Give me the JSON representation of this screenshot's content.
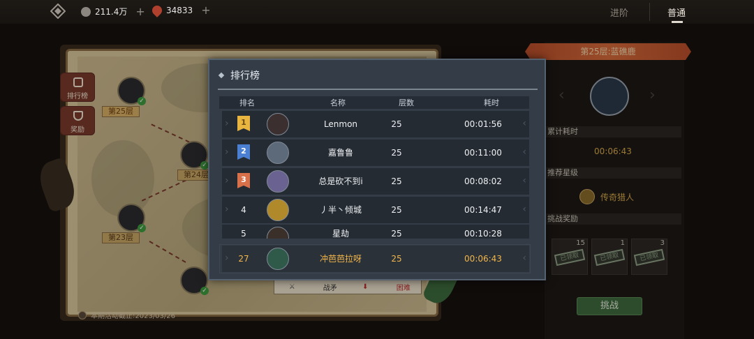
{
  "topbar": {
    "resources": [
      {
        "icon": "coin-icon",
        "value": "211.4万",
        "plus": "+"
      },
      {
        "icon": "blood-drop-icon",
        "value": "34833",
        "plus": "+"
      }
    ],
    "tabs": [
      {
        "label": "进阶",
        "active": false
      },
      {
        "label": "普通",
        "active": true
      }
    ]
  },
  "map": {
    "side_buttons": [
      {
        "icon": "leaderboard-icon",
        "label": "排行榜"
      },
      {
        "icon": "trophy-icon",
        "label": "奖励"
      }
    ],
    "floors": [
      {
        "label": "第25层",
        "cleared": true,
        "active": true
      },
      {
        "label": "第24层",
        "cleared": true,
        "active": false
      },
      {
        "label": "第23层",
        "cleared": true,
        "active": false
      }
    ],
    "card_tags": [
      {
        "icon": "sword-icon",
        "label": "战矛"
      },
      {
        "icon": "difficulty-icon",
        "label": "困难"
      }
    ],
    "deadline": "本期活动截止:2023/03/26"
  },
  "right_panel": {
    "level_title": "第25层:蓝礁鹿",
    "total_time_label": "累计耗时",
    "total_time_value": "00:06:43",
    "recommended_label": "推荐星级",
    "recommended_value": "传奇猎人",
    "rewards_label": "挑战奖励",
    "rewards": [
      {
        "count": "15",
        "stamp": "已领取"
      },
      {
        "count": "1",
        "stamp": "已领取"
      },
      {
        "count": "3",
        "stamp": "已领取"
      }
    ],
    "challenge_button": "挑战"
  },
  "leaderboard": {
    "title": "排行榜",
    "columns": [
      "排名",
      "名称",
      "层数",
      "耗时"
    ],
    "rows": [
      {
        "rank": "1",
        "name": "Lenmon",
        "floor": "25",
        "time": "00:01:56",
        "medal_color": "#e8b640"
      },
      {
        "rank": "2",
        "name": "嘉鲁鲁",
        "floor": "25",
        "time": "00:11:00",
        "medal_color": "#4a7fd1"
      },
      {
        "rank": "3",
        "name": "总是砍不到i",
        "floor": "25",
        "time": "00:08:02",
        "medal_color": "#d8704a"
      },
      {
        "rank": "4",
        "name": "丿半丶倾城",
        "floor": "25",
        "time": "00:14:47"
      },
      {
        "rank": "5",
        "name": "星劫",
        "floor": "25",
        "time": "00:10:28"
      }
    ],
    "self": {
      "rank": "27",
      "name": "冲芭芭拉呀",
      "floor": "25",
      "time": "00:06:43"
    }
  },
  "colors": {
    "modal_bg": "#343c48",
    "row_bg": "#252b33",
    "self_highlight": "#f2b64a",
    "banner": "#c95c30",
    "challenge_green": "#3e6a3e"
  }
}
